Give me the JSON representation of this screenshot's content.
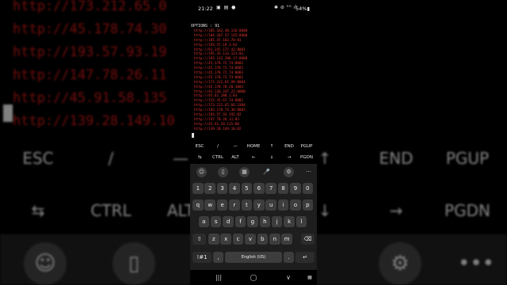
{
  "status_bar": {
    "time": "21:22",
    "left_icons": "▣ ▤ ●",
    "right_icons": "✱ ⊘ ⁵ᴳ ıl",
    "battery": "54%▮"
  },
  "terminal": {
    "header": "OPTIONS : 91",
    "proxies": [
      "http://185.162.40.116:8080",
      "http://104.207.37.125:8080",
      "http://185.47.183.70:83",
      "http://193.57.19.3:83",
      "http://91.247.177.42:8081",
      "http://195.35.114.121:83",
      "http://193.132.206.17:8080",
      "http://45.178.72.74:8081",
      "http://45.178.72.74:8082",
      "http://45.178.72.74:8083",
      "http://45.178.73.74:8081",
      "http://173.212.65.99:8084",
      "http://45.178.78.20:3003",
      "http://45.136.247.22:8080",
      "http://45.61.188.1:83",
      "http://152.35.67.74:8082",
      "http://173.212.65.66:3304",
      "http://193.178.74.30:8082",
      "http://193.57.93.192:82",
      "http://147.78.26.11:83",
      "http://45.91.58.135:80",
      "http://139.28.149.10:82"
    ]
  },
  "background": {
    "zoomed_lines": [
      "http://173.212.65.0",
      "http://45.178.74.30",
      "http://193.57.93.19",
      "http://147.78.26.11",
      "http://45.91.58.135",
      "http://139.28.149.10"
    ],
    "row1": [
      "ESC",
      "/",
      "—",
      "↑",
      "END",
      "PGUP"
    ],
    "row2": [
      "⇆",
      "CTRL",
      "ALT",
      "↓",
      "→",
      "PGDN"
    ],
    "bottom_icons": [
      "☺",
      "▯",
      "⚙",
      "•••"
    ]
  },
  "extra_keys": {
    "row1": [
      "ESC",
      "/",
      "—",
      "HOME",
      "↑",
      "END",
      "PGUP"
    ],
    "row2": [
      "⇆",
      "CTRL",
      "ALT",
      "←",
      "↓",
      "→",
      "PGDN"
    ]
  },
  "keyboard": {
    "toolbar": [
      "☺",
      "▯",
      "▦",
      "🎤",
      "⚙",
      "···"
    ],
    "numbers": [
      "1",
      "2",
      "3",
      "4",
      "5",
      "6",
      "7",
      "8",
      "9",
      "0"
    ],
    "row_q": [
      "q",
      "w",
      "e",
      "r",
      "t",
      "y",
      "u",
      "i",
      "o",
      "p"
    ],
    "row_a": [
      "a",
      "s",
      "d",
      "f",
      "g",
      "h",
      "j",
      "k",
      "l"
    ],
    "row_z": [
      "z",
      "x",
      "c",
      "v",
      "b",
      "n",
      "m"
    ],
    "shift": "⇧",
    "backspace": "⌫",
    "symbols": "!#1",
    "comma": ",",
    "space": "English (US)",
    "period": ".",
    "enter": "↵"
  },
  "nav_bar": {
    "recents": "|||",
    "home": "◯",
    "back": "∨",
    "keyboard_switch": "▦"
  }
}
